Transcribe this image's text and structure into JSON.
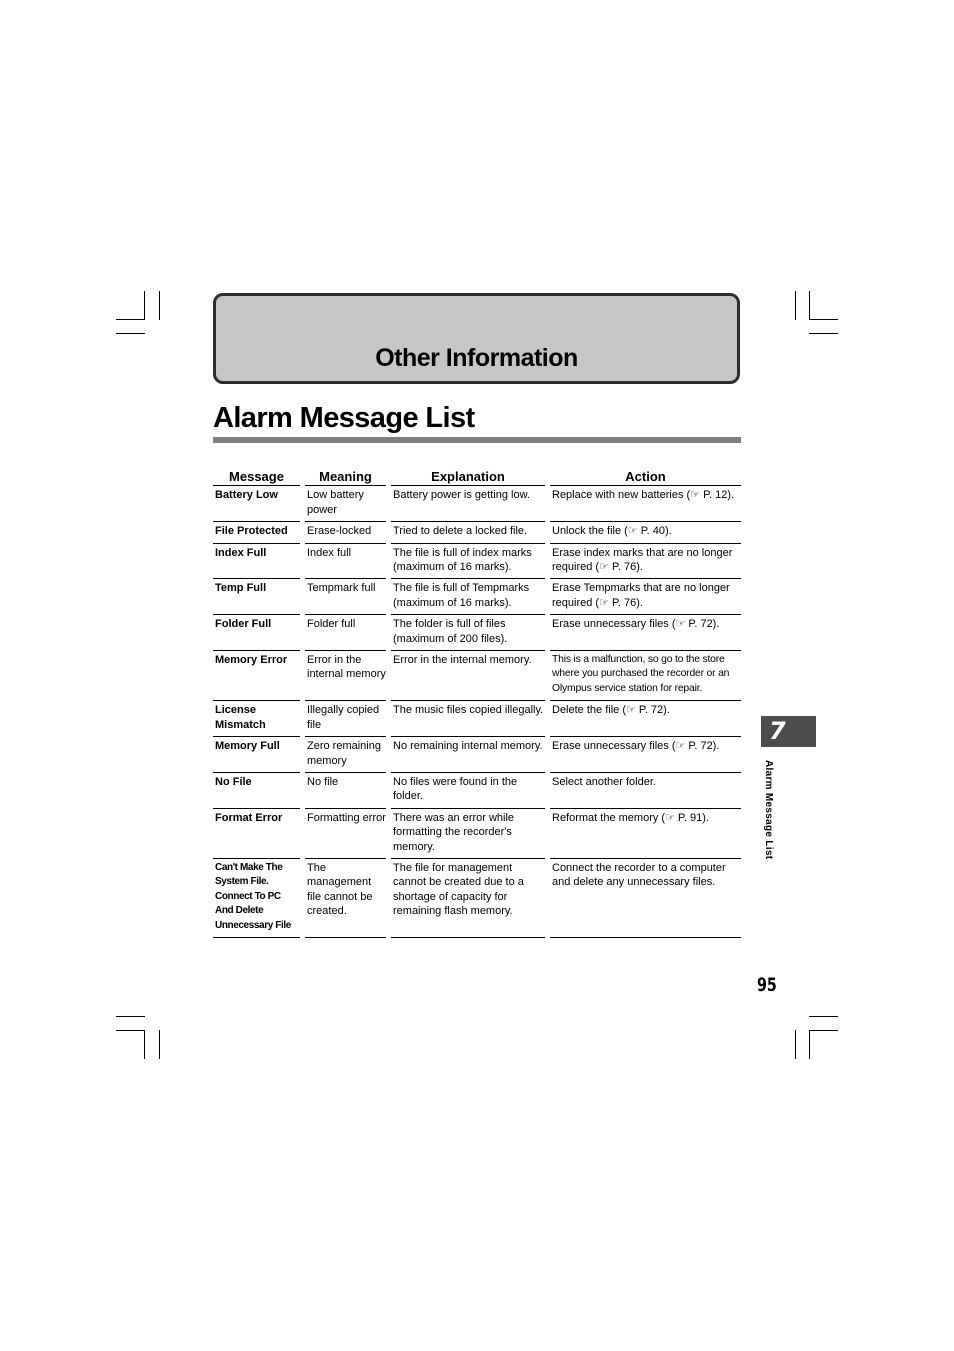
{
  "chapter": {
    "title": "Other Information"
  },
  "section": {
    "title": "Alarm Message List"
  },
  "table": {
    "headers": [
      "Message",
      "Meaning",
      "Explanation",
      "Action"
    ],
    "rows": [
      {
        "message": "Battery Low",
        "meaning": "Low battery power",
        "explanation": "Battery power is getting low.",
        "action": "Replace with new batteries (☞ P. 12)."
      },
      {
        "message": "File Protected",
        "meaning": "Erase-locked",
        "explanation": "Tried to delete a locked file.",
        "action": "Unlock the file (☞ P. 40)."
      },
      {
        "message": "Index Full",
        "meaning": "Index full",
        "explanation": "The file is full of index marks (maximum of 16 marks).",
        "action": "Erase index marks that are no longer required (☞ P. 76)."
      },
      {
        "message": "Temp Full",
        "meaning": "Tempmark full",
        "explanation": "The file is full of Tempmarks (maximum of 16 marks).",
        "action": "Erase Tempmarks that are no longer required (☞ P. 76)."
      },
      {
        "message": "Folder Full",
        "meaning": "Folder full",
        "explanation": "The folder is full of files (maximum of 200 files).",
        "action": "Erase unnecessary files (☞ P. 72)."
      },
      {
        "message": "Memory Error",
        "meaning": "Error in the internal memory",
        "explanation": "Error in the internal memory.",
        "action": "This is a malfunction, so go to the store where you purchased the recorder or an Olympus service station for repair."
      },
      {
        "message": "License Mismatch",
        "meaning": "Illegally copied file",
        "explanation": "The music files copied illegally.",
        "action": "Delete the file (☞ P. 72)."
      },
      {
        "message": "Memory Full",
        "meaning": "Zero remaining memory",
        "explanation": "No remaining internal memory.",
        "action": "Erase unnecessary files (☞ P. 72)."
      },
      {
        "message": "No File",
        "meaning": "No file",
        "explanation": "No files were found in the folder.",
        "action": "Select another folder."
      },
      {
        "message": "Format Error",
        "meaning": "Formatting error",
        "explanation": "There was an error while formatting the recorder's memory.",
        "action": "Reformat the memory (☞ P. 91)."
      },
      {
        "message": "Can't Make The System File. Connect To PC And Delete Unnecessary File",
        "meaning": "The management file cannot be created.",
        "explanation": "The file for management cannot be created due to a shortage of capacity for remaining flash memory.",
        "action": "Connect the recorder to a computer and delete any unnecessary files."
      }
    ]
  },
  "side_tab": {
    "chapter_number": "7",
    "label": "Alarm Message List"
  },
  "page_number": "95"
}
